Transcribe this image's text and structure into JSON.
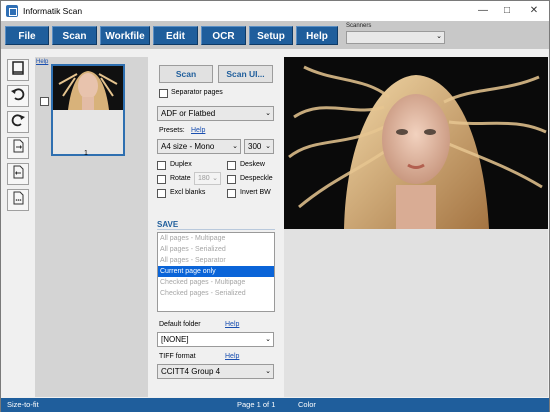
{
  "window": {
    "title": "Informatik Scan",
    "controls": [
      "minimize",
      "maximize",
      "close"
    ]
  },
  "menu": [
    {
      "label": "File",
      "name": "file"
    },
    {
      "label": "Scan",
      "name": "scan"
    },
    {
      "label": "Workfile",
      "name": "workfile"
    },
    {
      "label": "Edit",
      "name": "edit"
    },
    {
      "label": "OCR",
      "name": "ocr"
    },
    {
      "label": "Setup",
      "name": "setup"
    },
    {
      "label": "Help",
      "name": "help"
    }
  ],
  "scanners": {
    "label": "Scanners",
    "value": ""
  },
  "toolbar": {
    "icons": [
      "page-view-icon",
      "rotate-left-icon",
      "rotate-right-icon",
      "import-icon",
      "export-icon",
      "document-icon"
    ]
  },
  "thumbnails": {
    "help_link": "Help",
    "pages": [
      {
        "number": "1",
        "checked": false
      }
    ]
  },
  "settings": {
    "scan_button": "Scan",
    "scan_ui_button": "Scan UI...",
    "separator_pages": "Separator pages",
    "source": "ADF or Flatbed",
    "presets_label": "Presets:",
    "presets_help": "Help",
    "preset_value": "A4 size - Mono",
    "dpi_value": "300",
    "duplex": "Duplex",
    "deskew": "Deskew",
    "rotate": "Rotate",
    "rotate_value": "180",
    "despeckle": "Despeckle",
    "excl_blanks": "Excl blanks",
    "invert_bw": "Invert BW",
    "save_header": "SAVE",
    "save_options": [
      "All pages - Multipage",
      "All pages - Serialized",
      "All pages - Separator",
      "Current page only",
      "Checked pages - Multipage",
      "Checked pages - Serialized"
    ],
    "save_selected_index": 3,
    "default_folder_label": "Default folder",
    "default_folder_help": "Help",
    "default_folder_value": "[NONE]",
    "tiff_format_label": "TIFF format",
    "tiff_format_help": "Help",
    "tiff_format_value": "CCITT4 Group 4"
  },
  "status": {
    "fit": "Size-to-fit",
    "page": "Page 1 of 1",
    "color": "Color"
  },
  "colors": {
    "menu_blue": "#1f5e9c",
    "selection_blue": "#0a64d8"
  }
}
